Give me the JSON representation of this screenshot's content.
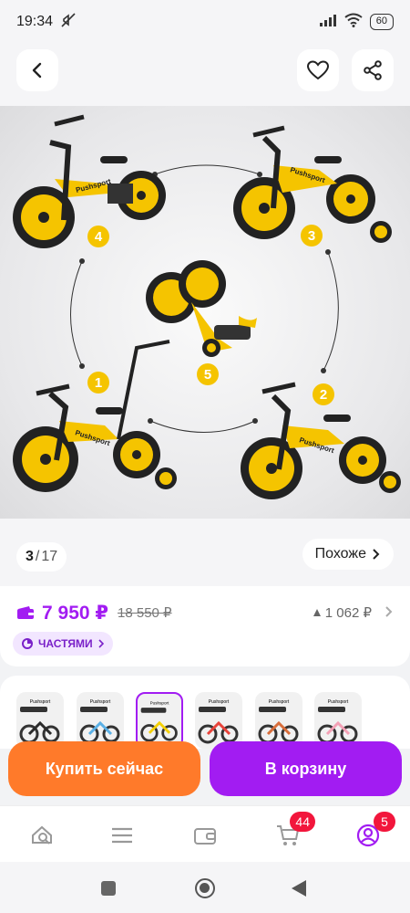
{
  "status_bar": {
    "time": "19:34",
    "battery": "60"
  },
  "gallery": {
    "current": "3",
    "total": "17",
    "similar_label": "Похоже",
    "callouts": [
      "1",
      "2",
      "3",
      "4",
      "5"
    ],
    "brand_text": "Pushsport"
  },
  "price": {
    "current": "7 950 ₽",
    "old": "18 550 ₽",
    "drop": "1 062 ₽",
    "parts_label": "ЧАСТЯМИ"
  },
  "thumbnails": [
    "Pushsport",
    "Pushsport",
    "Pushsport",
    "Pushsport",
    "Pushsport",
    "Pushsport"
  ],
  "thumbnail_colors": [
    "#2b2b2b",
    "#5ab0e6",
    "#f5d000",
    "#e8433a",
    "#d86d3a",
    "#f3a0b5"
  ],
  "actions": {
    "buy_now": "Купить сейчас",
    "to_cart": "В корзину"
  },
  "nav": {
    "cart_badge": "44",
    "profile_badge": "5"
  },
  "colors": {
    "accent": "#a21cf2",
    "orange": "#ff7a2a",
    "badge": "#f2163c",
    "bike_yellow": "#f5c400"
  }
}
